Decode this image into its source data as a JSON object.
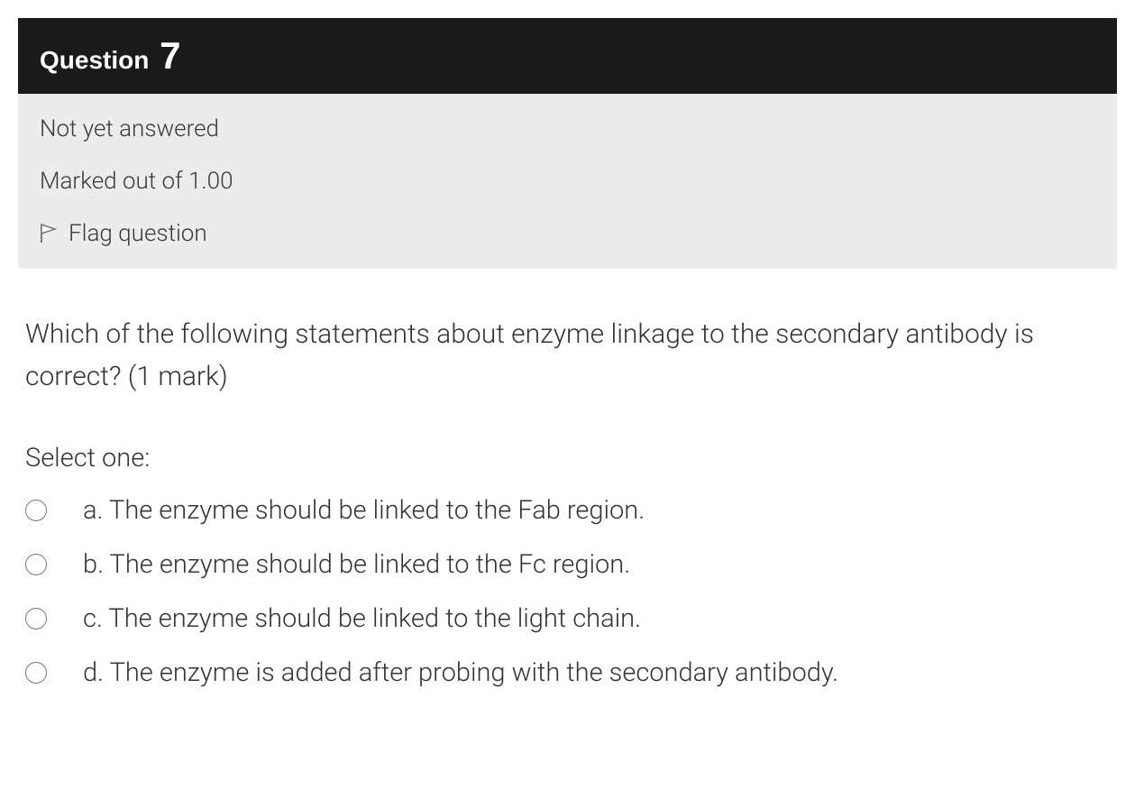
{
  "header": {
    "label": "Question",
    "number": "7"
  },
  "info": {
    "status": "Not yet answered",
    "marks": "Marked out of 1.00",
    "flag": "Flag question"
  },
  "question": {
    "text": "Which of the following statements about enzyme linkage to the secondary antibody is correct? (1 mark)",
    "selectLabel": "Select one:"
  },
  "options": [
    {
      "letter": "a.",
      "text": "The enzyme should be linked to the Fab region."
    },
    {
      "letter": "b.",
      "text": "The enzyme should be linked to the Fc region."
    },
    {
      "letter": "c.",
      "text": "The enzyme should be linked to the light chain."
    },
    {
      "letter": "d.",
      "text": "The enzyme is added after probing with the secondary antibody."
    }
  ]
}
